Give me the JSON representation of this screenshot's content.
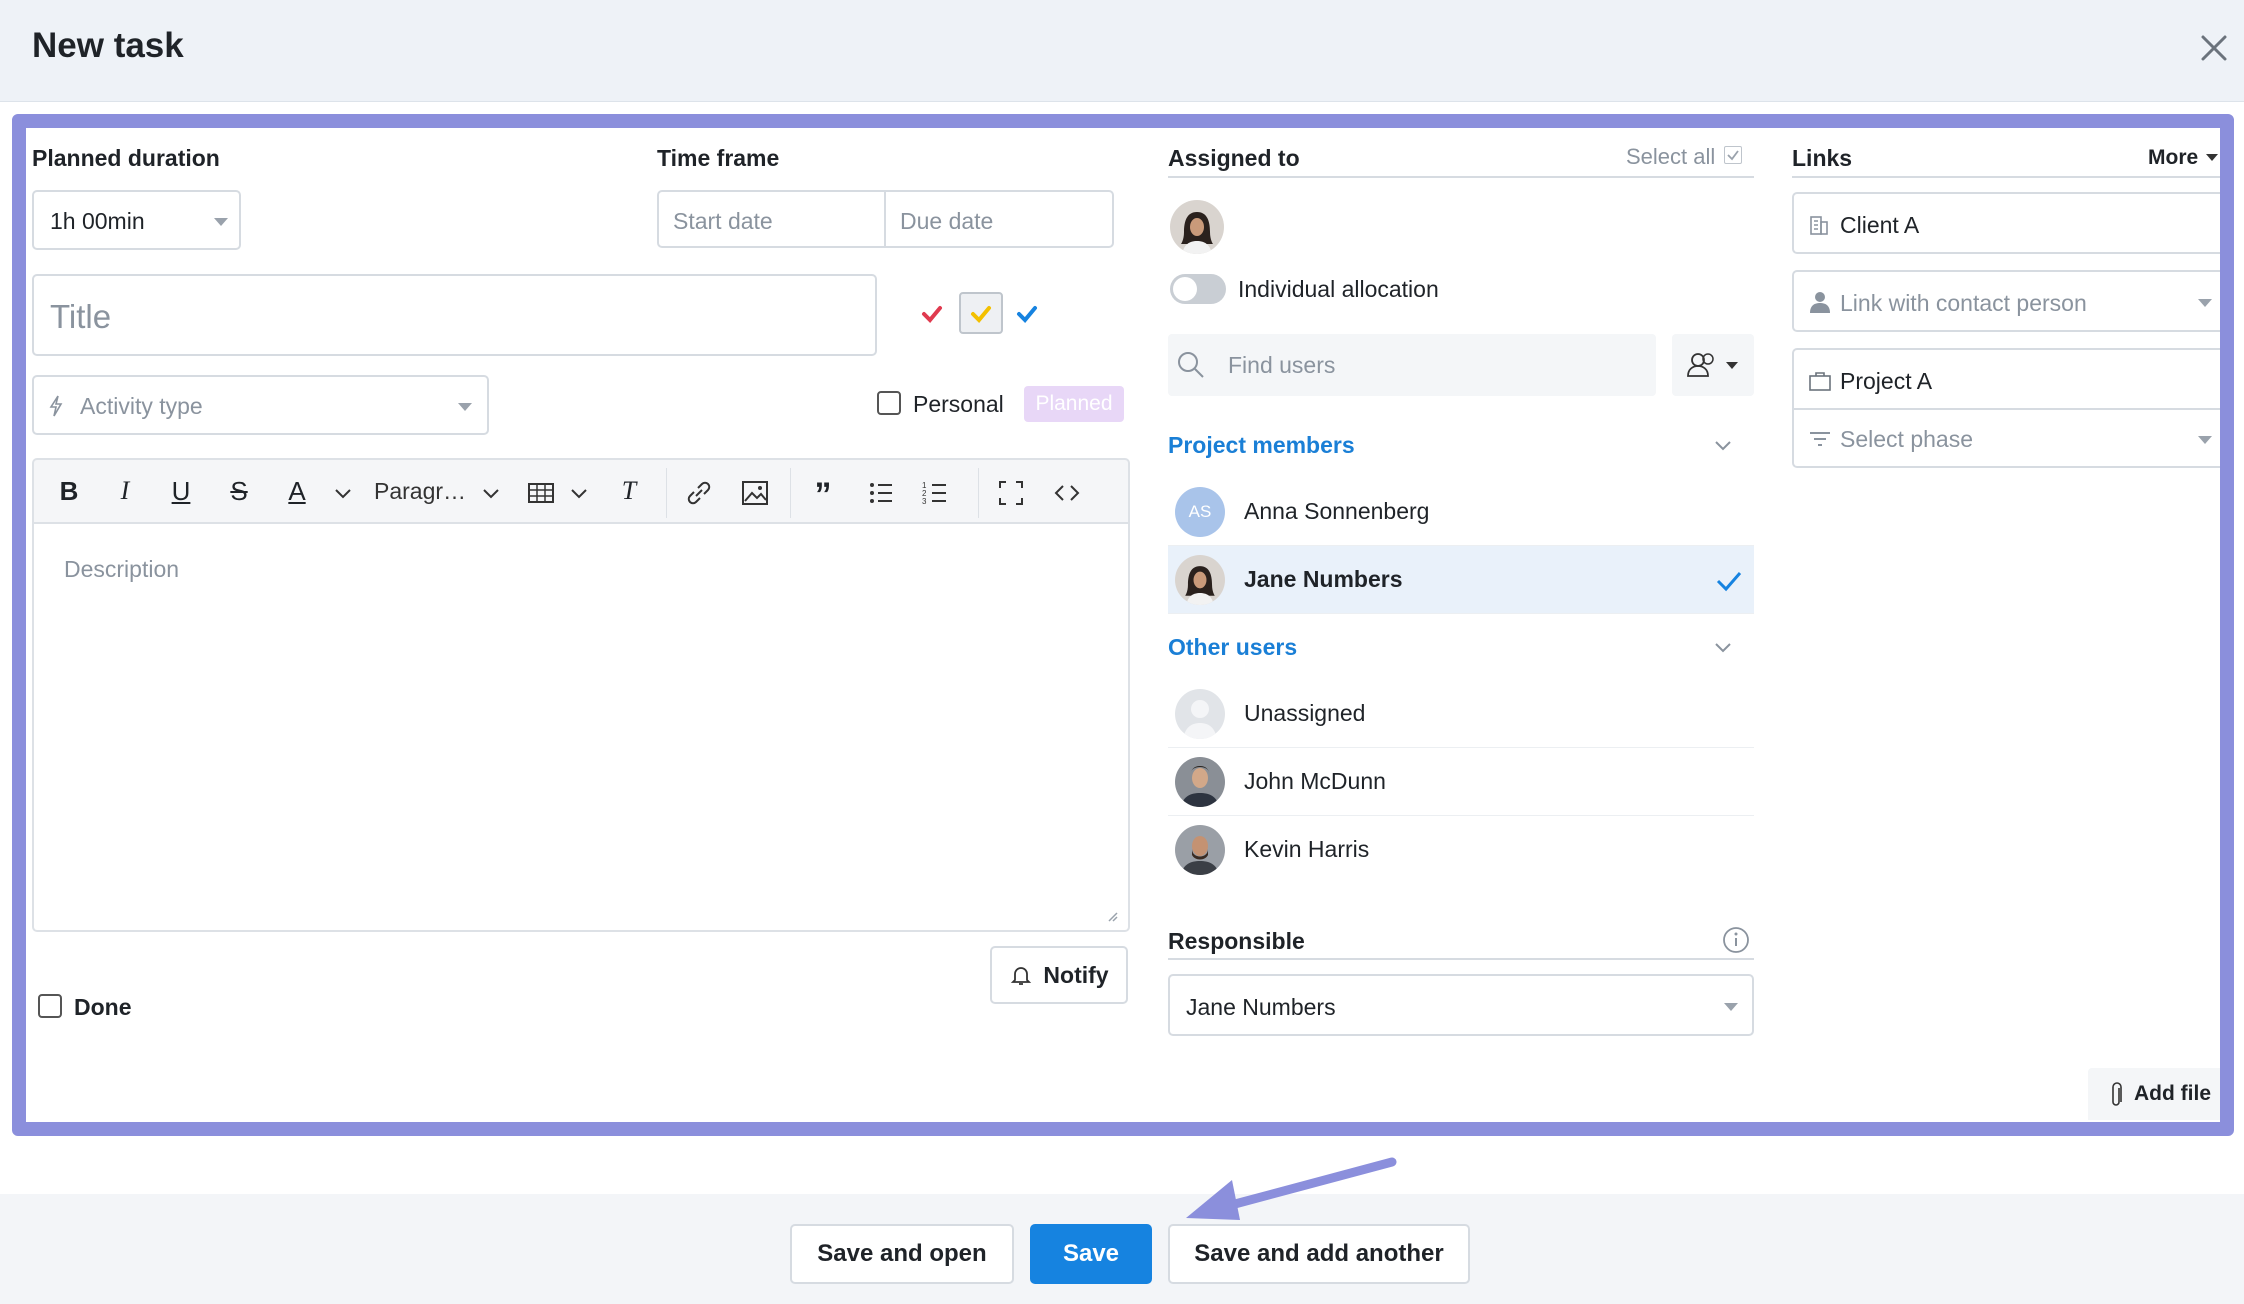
{
  "dialog": {
    "title": "New task"
  },
  "planned_duration": {
    "label": "Planned duration",
    "value": "1h 00min"
  },
  "time_frame": {
    "label": "Time frame",
    "start_placeholder": "Start date",
    "due_placeholder": "Due date"
  },
  "title_field": {
    "placeholder": "Title"
  },
  "activity_type": {
    "placeholder": "Activity type"
  },
  "personal": {
    "label": "Personal",
    "badge": "Planned"
  },
  "toolbar": {
    "paragraph_label": "Paragr…"
  },
  "description": {
    "placeholder": "Description"
  },
  "notify": {
    "label": "Notify"
  },
  "done": {
    "label": "Done"
  },
  "assigned": {
    "label": "Assigned to",
    "select_all": "Select all",
    "individual_allocation": "Individual allocation",
    "find_placeholder": "Find users",
    "project_members_label": "Project members",
    "other_users_label": "Other users",
    "project_members": [
      {
        "name": "Anna Sonnenberg",
        "initials": "AS",
        "selected": false
      },
      {
        "name": "Jane Numbers",
        "selected": true
      }
    ],
    "other_users": [
      {
        "name": "Unassigned"
      },
      {
        "name": "John McDunn"
      },
      {
        "name": "Kevin Harris"
      }
    ]
  },
  "responsible": {
    "label": "Responsible",
    "value": "Jane Numbers"
  },
  "links": {
    "label": "Links",
    "more": "More",
    "client": "Client A",
    "contact_placeholder": "Link with contact person",
    "project": "Project A",
    "phase_placeholder": "Select phase",
    "add_file": "Add file"
  },
  "footer": {
    "save_open": "Save and open",
    "save": "Save",
    "save_add": "Save and add another"
  },
  "colors": {
    "accent": "#1683e0",
    "highlight_frame": "#8b8fdc",
    "section_link": "#1a7fd6",
    "planned_badge": "#e8d7f7"
  }
}
